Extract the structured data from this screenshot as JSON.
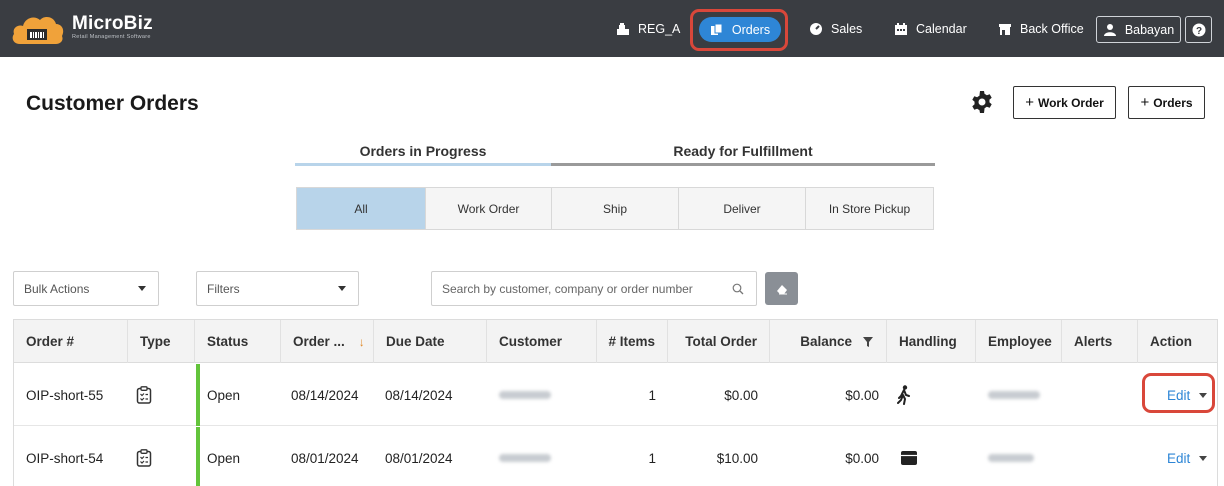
{
  "brand": {
    "name": "MicroBiz",
    "tagline": "Retail Management Software"
  },
  "nav": {
    "register": "REG_A",
    "orders": "Orders",
    "sales": "Sales",
    "calendar": "Calendar",
    "back_office": "Back Office",
    "user": "Babayan",
    "help": "?"
  },
  "page": {
    "title": "Customer Orders",
    "work_order_button": "Work Order",
    "orders_button": "Orders",
    "plus": "+"
  },
  "main_tabs": [
    {
      "label": "Orders in Progress",
      "active": true
    },
    {
      "label": "Ready for Fulfillment",
      "active": false
    }
  ],
  "sub_tabs": [
    {
      "label": "All",
      "active": true
    },
    {
      "label": "Work Order",
      "active": false
    },
    {
      "label": "Ship",
      "active": false
    },
    {
      "label": "Deliver",
      "active": false
    },
    {
      "label": "In Store Pickup",
      "active": false
    }
  ],
  "toolbar": {
    "bulk_actions": "Bulk Actions",
    "filters": "Filters",
    "search_placeholder": "Search by customer, company or order number"
  },
  "table": {
    "columns": [
      "Order #",
      "Type",
      "Status",
      "Order ...",
      "Due Date",
      "Customer",
      "# Items",
      "Total Order",
      "Balance",
      "Handling",
      "Employee",
      "Alerts",
      "Action"
    ],
    "rows": [
      {
        "order_number": "OIP-short-55",
        "type_icon": "clipboard-icon",
        "status": "Open",
        "order_date": "08/14/2024",
        "due_date": "08/14/2024",
        "items": "1",
        "total": "$0.00",
        "balance": "$0.00",
        "handling_icon": "walking-person-icon",
        "action": "Edit"
      },
      {
        "order_number": "OIP-short-54",
        "type_icon": "clipboard-icon",
        "status": "Open",
        "order_date": "08/01/2024",
        "due_date": "08/01/2024",
        "items": "1",
        "total": "$10.00",
        "balance": "$0.00",
        "handling_icon": "package-icon",
        "action": "Edit"
      }
    ]
  },
  "colors": {
    "topbar": "#3a3d42",
    "accent": "#2e86d6",
    "highlight": "#d9473a",
    "status_open": "#63c43b",
    "active_tab": "#b8d4ea"
  }
}
